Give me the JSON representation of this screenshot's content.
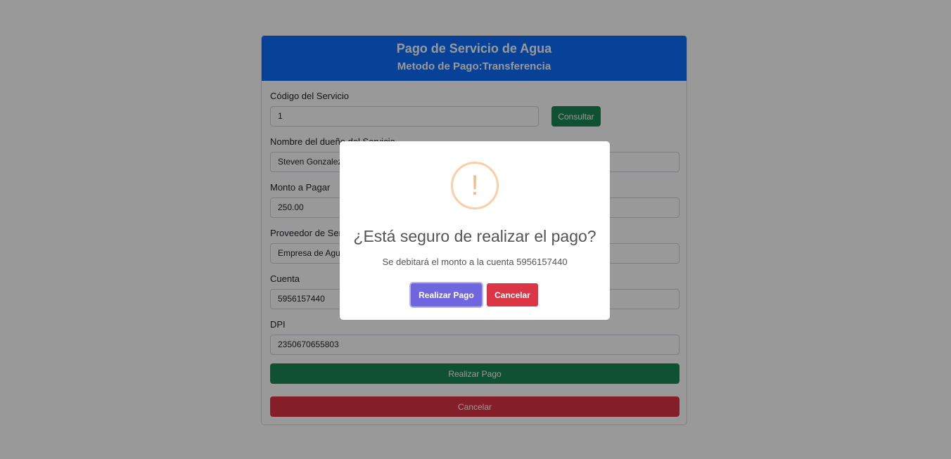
{
  "card": {
    "title": "Pago de Servicio de Agua",
    "subtitle": "Metodo de Pago:Transferencia"
  },
  "form": {
    "codigo": {
      "label": "Código del Servicio",
      "value": "1"
    },
    "consultar_label": "Consultar",
    "nombre": {
      "label": "Nombre del dueño del Servicio",
      "value": "Steven Gonzalez"
    },
    "monto": {
      "label": "Monto a Pagar",
      "value": "250.00"
    },
    "proveedor": {
      "label": "Proveedor de Servicio",
      "value": "Empresa de Agua"
    },
    "cuenta": {
      "label": "Cuenta",
      "value": "5956157440"
    },
    "dpi": {
      "label": "DPI",
      "value": "2350670655803"
    },
    "realizar_pago_label": "Realizar Pago",
    "cancelar_label": "Cancelar"
  },
  "modal": {
    "icon": "warning-icon",
    "icon_glyph": "!",
    "title": "¿Está seguro de realizar el pago?",
    "text": "Se debitará el monto a la cuenta 5956157440",
    "confirm_label": "Realizar Pago",
    "cancel_label": "Cancelar"
  },
  "colors": {
    "header": "#0d6efd",
    "success": "#198754",
    "danger": "#dc3545",
    "confirm": "#7066e0",
    "warning": "#f8bb86"
  }
}
